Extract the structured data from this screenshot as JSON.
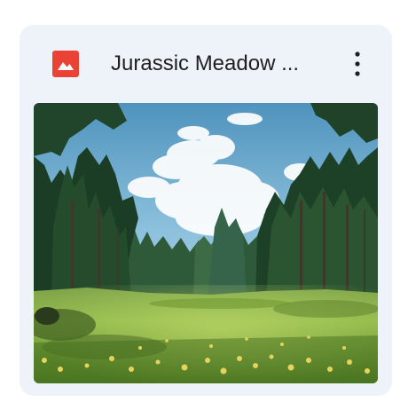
{
  "file": {
    "title": "Jurassic Meadow ...",
    "icon": "image-file-icon",
    "icon_color": "#ea4335"
  },
  "actions": {
    "more_icon": "more-vert-icon"
  },
  "colors": {
    "card_background": "#eef2f9",
    "title_text": "#1f1f1f"
  }
}
